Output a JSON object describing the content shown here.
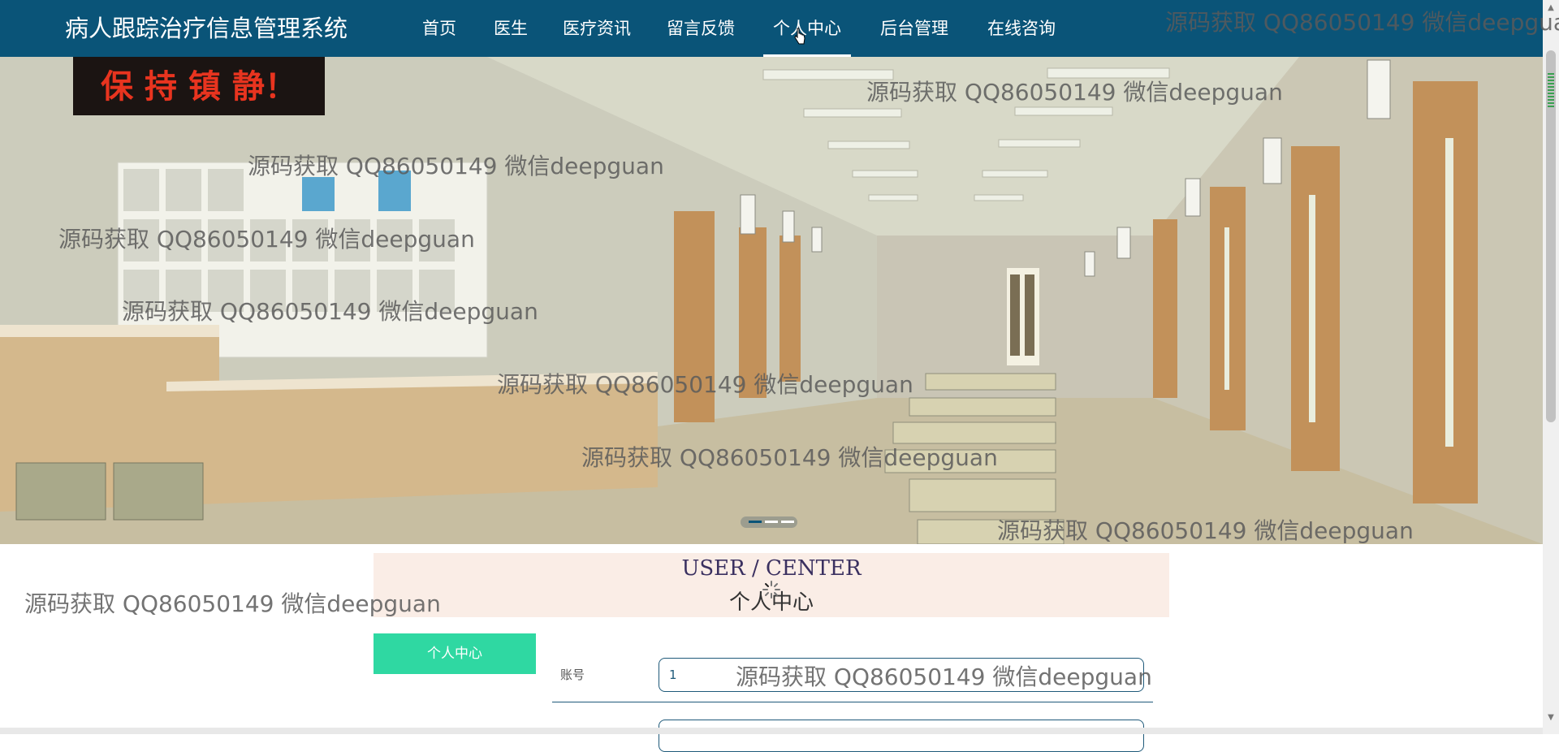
{
  "header": {
    "site_title": "病人跟踪治疗信息管理系统",
    "nav": [
      {
        "label": "首页"
      },
      {
        "label": "医生"
      },
      {
        "label": "医疗资讯"
      },
      {
        "label": "留言反馈"
      },
      {
        "label": "个人中心"
      },
      {
        "label": "后台管理"
      },
      {
        "label": "在线咨询"
      }
    ],
    "active_index": 4
  },
  "hero": {
    "sign_text": "保 持 镇 静！",
    "slides": 3,
    "active_slide": 0
  },
  "user_center": {
    "title_en": "USER / CENTER",
    "title_cn": "个人中心",
    "side_menu": [
      "个人中心"
    ],
    "form": {
      "account_label": "账号",
      "account_value": "1"
    }
  },
  "watermark_text": "源码获取 QQ86050149 微信deepguan",
  "colors": {
    "nav_bg": "#0a5478",
    "accent_green": "#2fd8a2",
    "header_bg": "#faede6"
  }
}
